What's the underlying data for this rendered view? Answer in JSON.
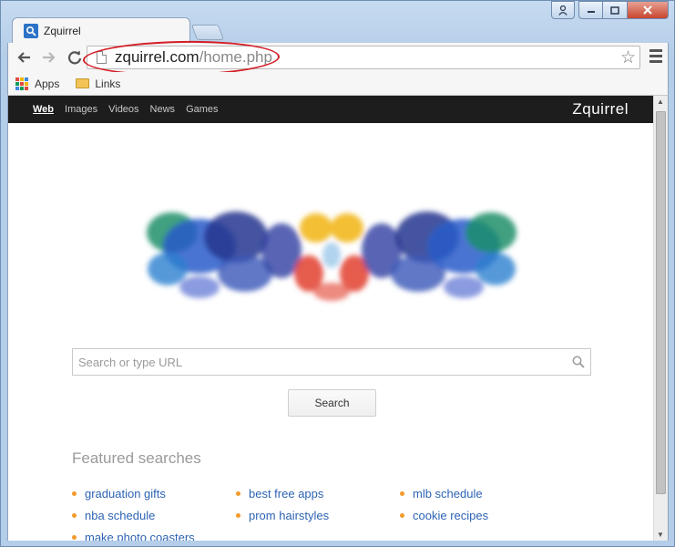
{
  "tab": {
    "title": "Zquirrel"
  },
  "omnibox": {
    "host": "zquirrel.com",
    "path": "/home.php"
  },
  "bookmarks": [
    {
      "label": "Apps",
      "icon": "apps-grid-icon"
    },
    {
      "label": "Links",
      "icon": "folder-icon"
    }
  ],
  "site": {
    "nav": [
      "Web",
      "Images",
      "Videos",
      "News",
      "Games"
    ],
    "active_nav": "Web",
    "logo": "Zquirrel"
  },
  "search": {
    "placeholder": "Search or type URL",
    "button_label": "Search"
  },
  "featured": {
    "title": "Featured searches",
    "items": [
      "graduation gifts",
      "best free apps",
      "mlb schedule",
      "nba schedule",
      "prom hairstyles",
      "cookie recipes",
      "make photo coasters"
    ]
  },
  "colors": {
    "link": "#2d63b4",
    "bullet": "#f29b2a",
    "annotation_oval": "#d41e27",
    "sitebar": "#1d1d1d"
  }
}
